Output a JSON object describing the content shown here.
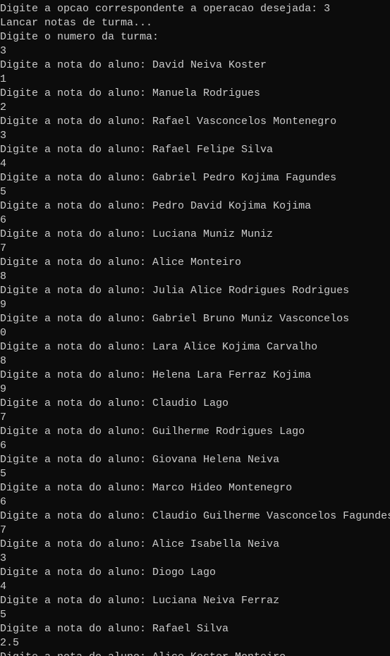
{
  "console": {
    "lines": [
      "Digite a opcao correspondente a operacao desejada: 3",
      "Lancar notas de turma...",
      "Digite o numero da turma:",
      "3",
      "Digite a nota do aluno: David Neiva Koster",
      "1",
      "Digite a nota do aluno: Manuela Rodrigues",
      "2",
      "Digite a nota do aluno: Rafael Vasconcelos Montenegro",
      "3",
      "Digite a nota do aluno: Rafael Felipe Silva",
      "4",
      "Digite a nota do aluno: Gabriel Pedro Kojima Fagundes",
      "5",
      "Digite a nota do aluno: Pedro David Kojima Kojima",
      "6",
      "Digite a nota do aluno: Luciana Muniz Muniz",
      "7",
      "Digite a nota do aluno: Alice Monteiro",
      "8",
      "Digite a nota do aluno: Julia Alice Rodrigues Rodrigues",
      "9",
      "Digite a nota do aluno: Gabriel Bruno Muniz Vasconcelos",
      "0",
      "Digite a nota do aluno: Lara Alice Kojima Carvalho",
      "8",
      "Digite a nota do aluno: Helena Lara Ferraz Kojima",
      "9",
      "Digite a nota do aluno: Claudio Lago",
      "7",
      "Digite a nota do aluno: Guilherme Rodrigues Lago",
      "6",
      "Digite a nota do aluno: Giovana Helena Neiva",
      "5",
      "Digite a nota do aluno: Marco Hideo Montenegro",
      "6",
      "Digite a nota do aluno: Claudio Guilherme Vasconcelos Fagundes",
      "7",
      "Digite a nota do aluno: Alice Isabella Neiva",
      "3",
      "Digite a nota do aluno: Diogo Lago",
      "4",
      "Digite a nota do aluno: Luciana Neiva Ferraz",
      "5",
      "Digite a nota do aluno: Rafael Silva",
      "2.5",
      "Digite a nota do aluno: Alice Koster Monteiro"
    ]
  }
}
